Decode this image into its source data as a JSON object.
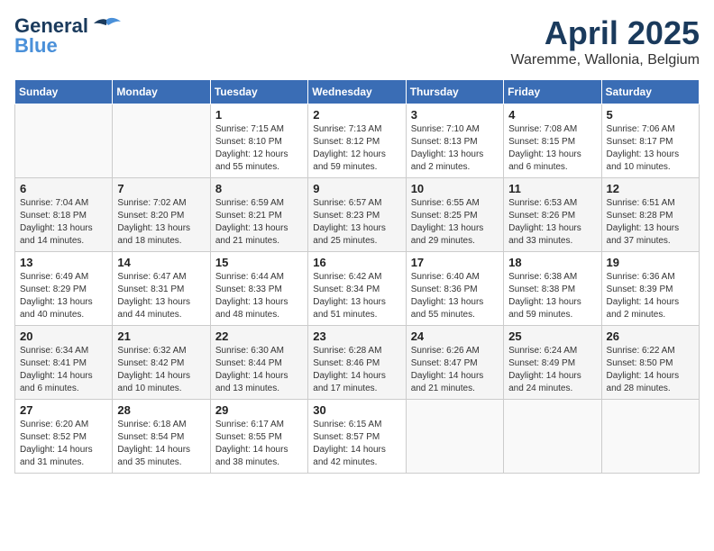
{
  "header": {
    "logo_line1": "General",
    "logo_line2": "Blue",
    "title": "April 2025",
    "subtitle": "Waremme, Wallonia, Belgium"
  },
  "weekdays": [
    "Sunday",
    "Monday",
    "Tuesday",
    "Wednesday",
    "Thursday",
    "Friday",
    "Saturday"
  ],
  "weeks": [
    [
      {
        "day": "",
        "sunrise": "",
        "sunset": "",
        "daylight": ""
      },
      {
        "day": "",
        "sunrise": "",
        "sunset": "",
        "daylight": ""
      },
      {
        "day": "1",
        "sunrise": "Sunrise: 7:15 AM",
        "sunset": "Sunset: 8:10 PM",
        "daylight": "Daylight: 12 hours and 55 minutes."
      },
      {
        "day": "2",
        "sunrise": "Sunrise: 7:13 AM",
        "sunset": "Sunset: 8:12 PM",
        "daylight": "Daylight: 12 hours and 59 minutes."
      },
      {
        "day": "3",
        "sunrise": "Sunrise: 7:10 AM",
        "sunset": "Sunset: 8:13 PM",
        "daylight": "Daylight: 13 hours and 2 minutes."
      },
      {
        "day": "4",
        "sunrise": "Sunrise: 7:08 AM",
        "sunset": "Sunset: 8:15 PM",
        "daylight": "Daylight: 13 hours and 6 minutes."
      },
      {
        "day": "5",
        "sunrise": "Sunrise: 7:06 AM",
        "sunset": "Sunset: 8:17 PM",
        "daylight": "Daylight: 13 hours and 10 minutes."
      }
    ],
    [
      {
        "day": "6",
        "sunrise": "Sunrise: 7:04 AM",
        "sunset": "Sunset: 8:18 PM",
        "daylight": "Daylight: 13 hours and 14 minutes."
      },
      {
        "day": "7",
        "sunrise": "Sunrise: 7:02 AM",
        "sunset": "Sunset: 8:20 PM",
        "daylight": "Daylight: 13 hours and 18 minutes."
      },
      {
        "day": "8",
        "sunrise": "Sunrise: 6:59 AM",
        "sunset": "Sunset: 8:21 PM",
        "daylight": "Daylight: 13 hours and 21 minutes."
      },
      {
        "day": "9",
        "sunrise": "Sunrise: 6:57 AM",
        "sunset": "Sunset: 8:23 PM",
        "daylight": "Daylight: 13 hours and 25 minutes."
      },
      {
        "day": "10",
        "sunrise": "Sunrise: 6:55 AM",
        "sunset": "Sunset: 8:25 PM",
        "daylight": "Daylight: 13 hours and 29 minutes."
      },
      {
        "day": "11",
        "sunrise": "Sunrise: 6:53 AM",
        "sunset": "Sunset: 8:26 PM",
        "daylight": "Daylight: 13 hours and 33 minutes."
      },
      {
        "day": "12",
        "sunrise": "Sunrise: 6:51 AM",
        "sunset": "Sunset: 8:28 PM",
        "daylight": "Daylight: 13 hours and 37 minutes."
      }
    ],
    [
      {
        "day": "13",
        "sunrise": "Sunrise: 6:49 AM",
        "sunset": "Sunset: 8:29 PM",
        "daylight": "Daylight: 13 hours and 40 minutes."
      },
      {
        "day": "14",
        "sunrise": "Sunrise: 6:47 AM",
        "sunset": "Sunset: 8:31 PM",
        "daylight": "Daylight: 13 hours and 44 minutes."
      },
      {
        "day": "15",
        "sunrise": "Sunrise: 6:44 AM",
        "sunset": "Sunset: 8:33 PM",
        "daylight": "Daylight: 13 hours and 48 minutes."
      },
      {
        "day": "16",
        "sunrise": "Sunrise: 6:42 AM",
        "sunset": "Sunset: 8:34 PM",
        "daylight": "Daylight: 13 hours and 51 minutes."
      },
      {
        "day": "17",
        "sunrise": "Sunrise: 6:40 AM",
        "sunset": "Sunset: 8:36 PM",
        "daylight": "Daylight: 13 hours and 55 minutes."
      },
      {
        "day": "18",
        "sunrise": "Sunrise: 6:38 AM",
        "sunset": "Sunset: 8:38 PM",
        "daylight": "Daylight: 13 hours and 59 minutes."
      },
      {
        "day": "19",
        "sunrise": "Sunrise: 6:36 AM",
        "sunset": "Sunset: 8:39 PM",
        "daylight": "Daylight: 14 hours and 2 minutes."
      }
    ],
    [
      {
        "day": "20",
        "sunrise": "Sunrise: 6:34 AM",
        "sunset": "Sunset: 8:41 PM",
        "daylight": "Daylight: 14 hours and 6 minutes."
      },
      {
        "day": "21",
        "sunrise": "Sunrise: 6:32 AM",
        "sunset": "Sunset: 8:42 PM",
        "daylight": "Daylight: 14 hours and 10 minutes."
      },
      {
        "day": "22",
        "sunrise": "Sunrise: 6:30 AM",
        "sunset": "Sunset: 8:44 PM",
        "daylight": "Daylight: 14 hours and 13 minutes."
      },
      {
        "day": "23",
        "sunrise": "Sunrise: 6:28 AM",
        "sunset": "Sunset: 8:46 PM",
        "daylight": "Daylight: 14 hours and 17 minutes."
      },
      {
        "day": "24",
        "sunrise": "Sunrise: 6:26 AM",
        "sunset": "Sunset: 8:47 PM",
        "daylight": "Daylight: 14 hours and 21 minutes."
      },
      {
        "day": "25",
        "sunrise": "Sunrise: 6:24 AM",
        "sunset": "Sunset: 8:49 PM",
        "daylight": "Daylight: 14 hours and 24 minutes."
      },
      {
        "day": "26",
        "sunrise": "Sunrise: 6:22 AM",
        "sunset": "Sunset: 8:50 PM",
        "daylight": "Daylight: 14 hours and 28 minutes."
      }
    ],
    [
      {
        "day": "27",
        "sunrise": "Sunrise: 6:20 AM",
        "sunset": "Sunset: 8:52 PM",
        "daylight": "Daylight: 14 hours and 31 minutes."
      },
      {
        "day": "28",
        "sunrise": "Sunrise: 6:18 AM",
        "sunset": "Sunset: 8:54 PM",
        "daylight": "Daylight: 14 hours and 35 minutes."
      },
      {
        "day": "29",
        "sunrise": "Sunrise: 6:17 AM",
        "sunset": "Sunset: 8:55 PM",
        "daylight": "Daylight: 14 hours and 38 minutes."
      },
      {
        "day": "30",
        "sunrise": "Sunrise: 6:15 AM",
        "sunset": "Sunset: 8:57 PM",
        "daylight": "Daylight: 14 hours and 42 minutes."
      },
      {
        "day": "",
        "sunrise": "",
        "sunset": "",
        "daylight": ""
      },
      {
        "day": "",
        "sunrise": "",
        "sunset": "",
        "daylight": ""
      },
      {
        "day": "",
        "sunrise": "",
        "sunset": "",
        "daylight": ""
      }
    ]
  ]
}
